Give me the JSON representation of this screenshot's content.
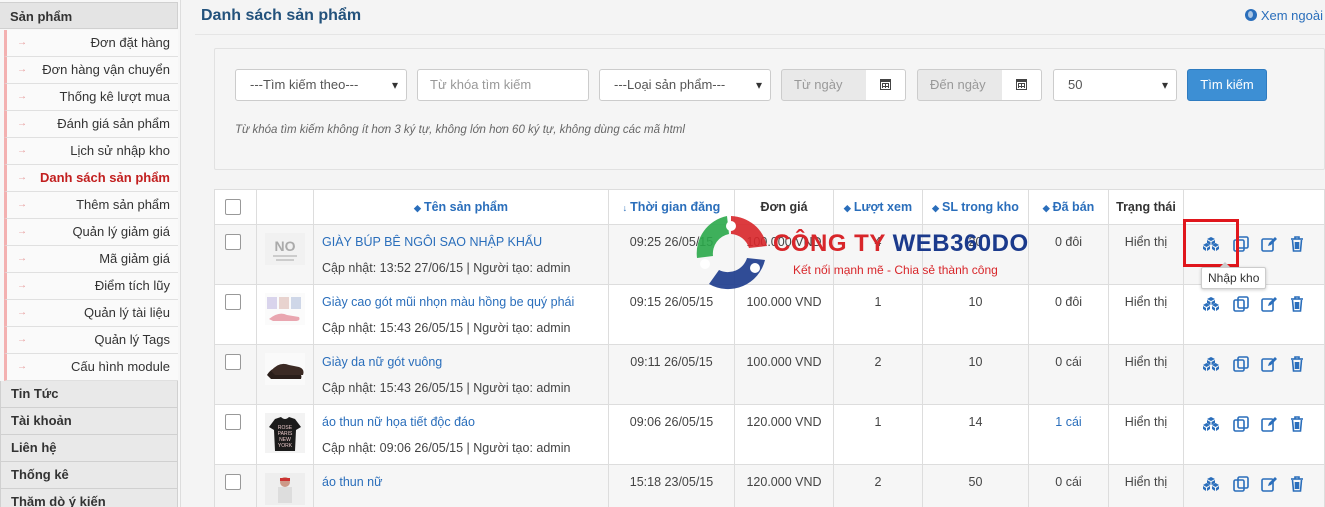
{
  "sidebar": {
    "group_title": "Sản phẩm",
    "items": [
      {
        "label": "Đơn đặt hàng",
        "active": false
      },
      {
        "label": "Đơn hàng vận chuyển",
        "active": false
      },
      {
        "label": "Thống kê lượt mua",
        "active": false
      },
      {
        "label": "Đánh giá sản phẩm",
        "active": false
      },
      {
        "label": "Lịch sử nhập kho",
        "active": false
      },
      {
        "label": "Danh sách sản phẩm",
        "active": true
      },
      {
        "label": "Thêm sản phẩm",
        "active": false
      },
      {
        "label": "Quản lý giảm giá",
        "active": false
      },
      {
        "label": "Mã giảm giá",
        "active": false
      },
      {
        "label": "Điểm tích lũy",
        "active": false
      },
      {
        "label": "Quản lý tài liệu",
        "active": false
      },
      {
        "label": "Quản lý Tags",
        "active": false
      },
      {
        "label": "Cấu hình module",
        "active": false
      }
    ],
    "sections": [
      "Tin Tức",
      "Tài khoản",
      "Liên hệ",
      "Thống kê",
      "Thăm dò ý kiến"
    ],
    "arrow_glyph": "→"
  },
  "header": {
    "title": "Danh sách sản phẩm",
    "view_outside": "Xem ngoài"
  },
  "search": {
    "search_by": "---Tìm kiếm theo---",
    "keyword_placeholder": "Từ khóa tìm kiếm",
    "product_type": "---Loại sản phẩm---",
    "from_date_placeholder": "Từ ngày",
    "to_date_placeholder": "Đến ngày",
    "page_size": "50",
    "button": "Tìm kiếm",
    "hint": "Từ khóa tìm kiếm không ít hơn 3 ký tự, không lớn hơn 60 ký tự, không dùng các mã html"
  },
  "table": {
    "columns": {
      "name": "Tên sản phẩm",
      "posted": "Thời gian đăng",
      "price": "Đơn giá",
      "views": "Lượt xem",
      "stock": "SL trong kho",
      "sold": "Đã bán",
      "status": "Trạng thái"
    },
    "rows": [
      {
        "name": "GIÀY BÚP BÊ NGÔI SAO NHẬP KHẨU",
        "meta": "Cập nhật: 13:52 27/06/15 | Người tạo: admin",
        "posted": "09:25 26/05/15",
        "price": "100.000 VND",
        "views": "4",
        "stock": "20",
        "sold": "0 đôi",
        "sold_link": false,
        "status": "Hiển thị",
        "thumb": "no-image"
      },
      {
        "name": "Giày cao gót mũi nhọn màu hồng be quý phái",
        "meta": "Cập nhật: 15:43 26/05/15 | Người tạo: admin",
        "posted": "09:15 26/05/15",
        "price": "100.000 VND",
        "views": "1",
        "stock": "10",
        "sold": "0 đôi",
        "sold_link": false,
        "status": "Hiển thị",
        "thumb": "pink-shoes"
      },
      {
        "name": "Giày da nữ gót vuông",
        "meta": "Cập nhật: 15:43 26/05/15 | Người tạo: admin",
        "posted": "09:11 26/05/15",
        "price": "100.000 VND",
        "views": "2",
        "stock": "10",
        "sold": "0 cái",
        "sold_link": false,
        "status": "Hiển thị",
        "thumb": "black-shoes"
      },
      {
        "name": "áo thun nữ họa tiết độc đáo",
        "meta": "Cập nhật: 09:06 26/05/15 | Người tạo: admin",
        "posted": "09:06 26/05/15",
        "price": "120.000 VND",
        "views": "1",
        "stock": "14",
        "sold": "1 cái",
        "sold_link": true,
        "status": "Hiển thị",
        "thumb": "tshirt"
      },
      {
        "name": "áo thun nữ",
        "meta": "",
        "posted": "15:18 23/05/15",
        "price": "120.000 VND",
        "views": "2",
        "stock": "50",
        "sold": "0 cái",
        "sold_link": false,
        "status": "Hiển thị",
        "thumb": "person"
      }
    ],
    "no_image_text": "NO",
    "tshirt_lines": [
      "ROSE",
      "PARIS",
      "NEW",
      "YORK"
    ]
  },
  "tooltip": "Nhập kho",
  "watermark": {
    "title_a": "CÔNG TY ",
    "title_b": "WEB360DO",
    "subtitle": "Kết nối mạnh mẽ - Chia sẻ thành công"
  },
  "colors": {
    "accent": "#2a6ebb",
    "active": "#c21f1f",
    "button": "#3d8fd4",
    "highlight": "#e0161c"
  }
}
